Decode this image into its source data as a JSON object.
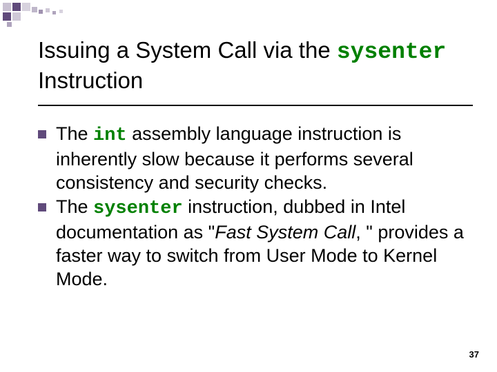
{
  "title": {
    "pre": "Issuing a System Call via the ",
    "code": "sysenter",
    "post": " Instruction"
  },
  "bullets": [
    {
      "seg1": "The ",
      "code1": "int",
      "seg2": " assembly language instruction is inherently slow because it performs several consistency and security checks."
    },
    {
      "seg1": "The ",
      "code1": "sysenter",
      "seg2": " instruction, dubbed in Intel documentation as \"",
      "ital": "Fast System Call",
      "seg3": ", \" provides a faster way to switch from User Mode to Kernel Mode."
    }
  ],
  "page_number": "37"
}
